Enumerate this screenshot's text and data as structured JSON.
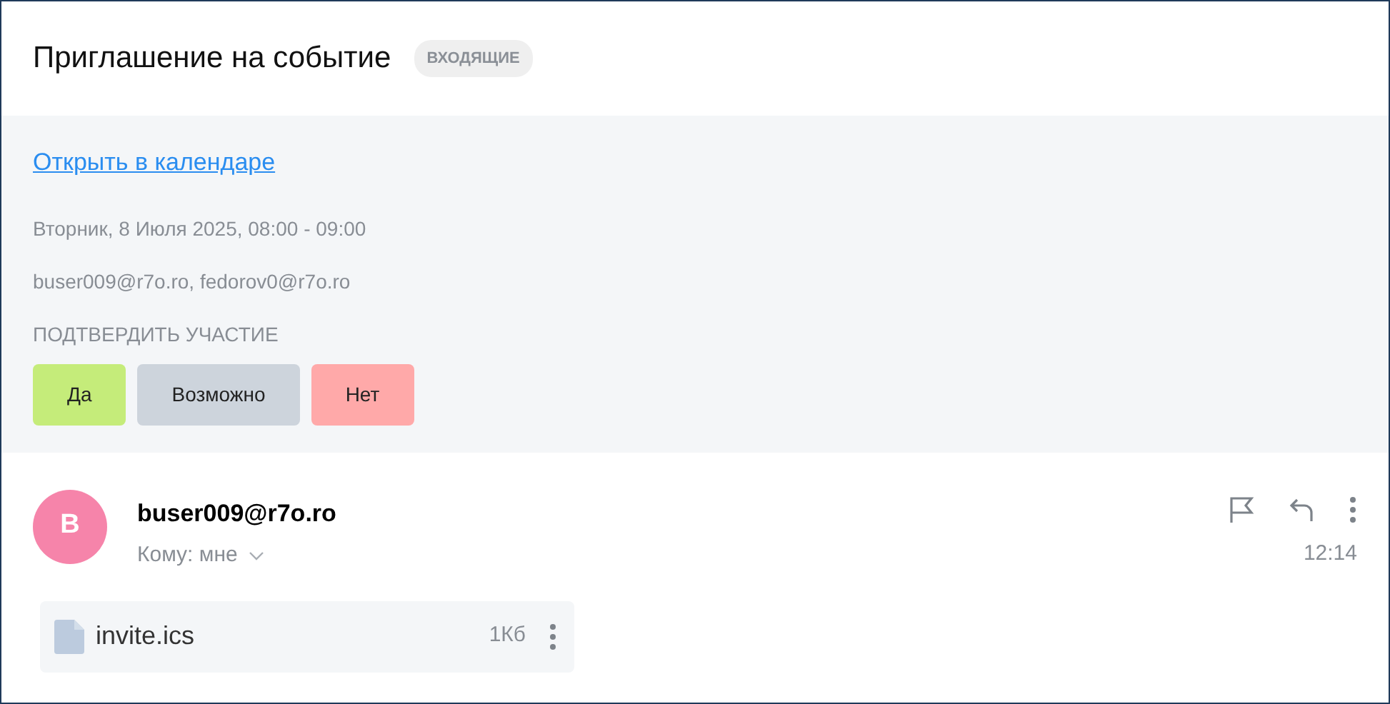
{
  "header": {
    "title": "Приглашение на событие",
    "folder_badge": "ВХОДЯЩИЕ"
  },
  "event": {
    "calendar_link": "Открыть в календаре",
    "date": "Вторник, 8 Июля 2025, 08:00 - 09:00",
    "attendees": "buser009@r7o.ro, fedorov0@r7o.ro",
    "rsvp_label": "ПОДТВЕРДИТЬ УЧАСТИЕ",
    "rsvp_buttons": [
      {
        "label": "Да",
        "color": "#c5ec7a"
      },
      {
        "label": "Возможно",
        "color": "#cdd4dc"
      },
      {
        "label": "Нет",
        "color": "#ffa9a9"
      }
    ]
  },
  "message": {
    "avatar_letter": "B",
    "sender": "buser009@r7o.ro",
    "recipient": "Кому: мне",
    "time": "12:14"
  },
  "attachments": [
    {
      "name": "invite.ics",
      "size": "1Кб"
    }
  ]
}
